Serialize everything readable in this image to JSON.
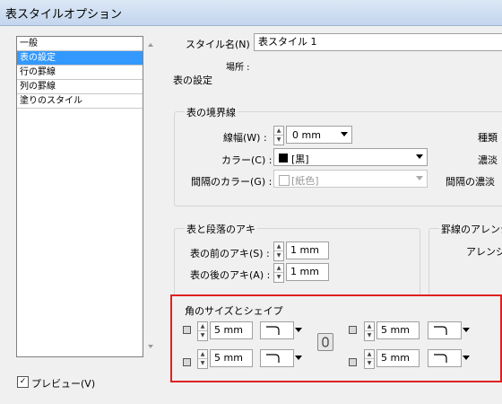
{
  "window": {
    "title": "表スタイルオプション"
  },
  "sidebar": {
    "items": [
      {
        "label": "一般"
      },
      {
        "label": "表の設定"
      },
      {
        "label": "行の罫線"
      },
      {
        "label": "列の罫線"
      },
      {
        "label": "塗りのスタイル"
      }
    ]
  },
  "style": {
    "name_label": "スタイル名(N) :",
    "name_value": "表スタイル 1",
    "location_label": "場所 :"
  },
  "section_title": "表の設定",
  "border": {
    "group_title": "表の境界線",
    "weight_label": "線幅(W) :",
    "weight_value": "0 mm",
    "color_label": "カラー(C) :",
    "color_value": "[黒]",
    "gap_color_label": "間隔のカラー(G) :",
    "gap_color_value": "[紙色]",
    "type_label": "種類",
    "tint_label": "濃淡",
    "gap_tint_label": "間隔の濃淡"
  },
  "spacing": {
    "group_title": "表と段落のアキ",
    "before_label": "表の前のアキ(S) :",
    "before_value": "1 mm",
    "after_label": "表の後のアキ(A) :",
    "after_value": "1 mm"
  },
  "stroke_arrange": {
    "group_title": "罫線のアレンジ",
    "arrange_label": "アレンジ"
  },
  "corner": {
    "group_title": "角のサイズとシェイプ",
    "top_left_value": "5 mm",
    "bottom_left_value": "5 mm",
    "top_right_value": "5 mm",
    "bottom_right_value": "5 mm"
  },
  "preview": {
    "label": "プレビュー(V)",
    "checked": "✓"
  },
  "colors": {
    "accent": "#3399ff",
    "highlight_box": "#e02020"
  }
}
